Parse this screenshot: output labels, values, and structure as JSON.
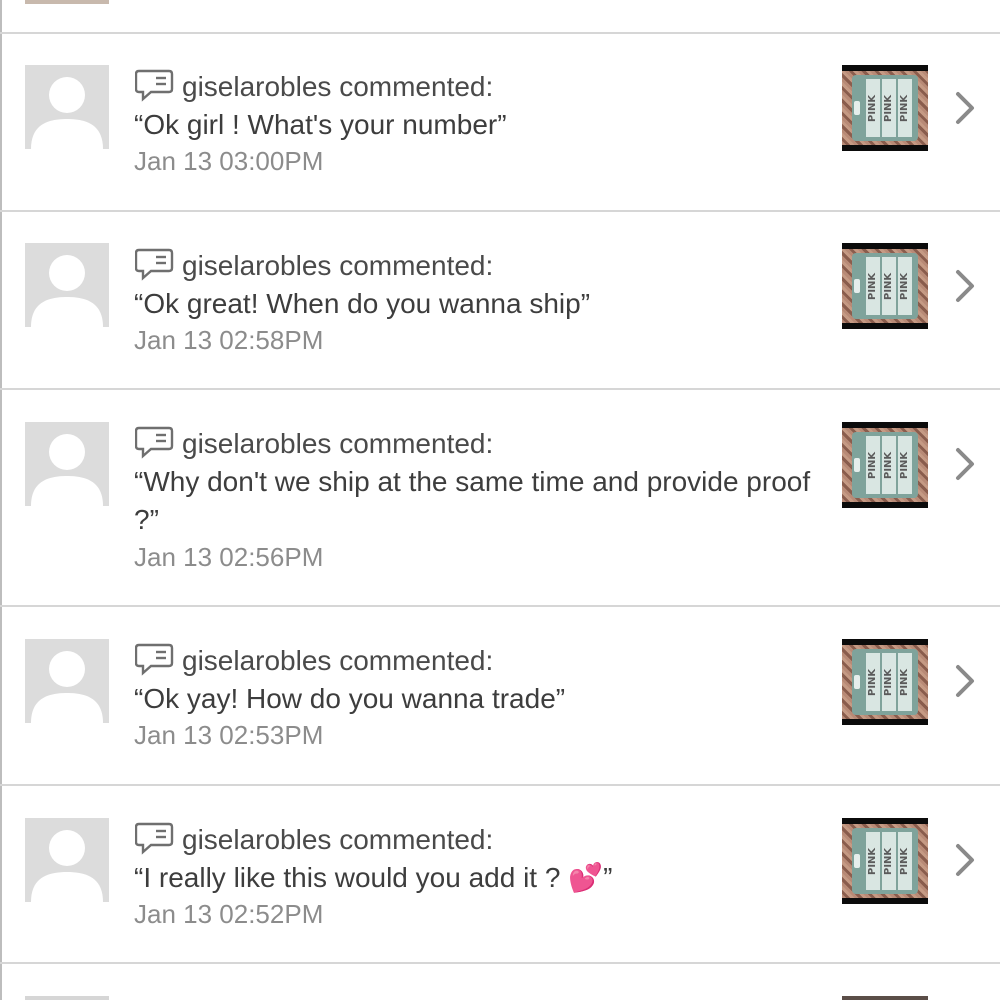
{
  "notifications": [
    {
      "user": "giselarobles commented:",
      "message": "“Ok girl ! What's your number”",
      "time": "Jan 13 03:00PM",
      "thumb_brand": "PINK"
    },
    {
      "user": "giselarobles commented:",
      "message": "“Ok great! When do you wanna ship”",
      "time": "Jan 13 02:58PM",
      "thumb_brand": "PINK"
    },
    {
      "user": "giselarobles commented:",
      "message": "“Why don't we ship at the same time and provide proof ?”",
      "time": "Jan 13 02:56PM",
      "thumb_brand": "PINK"
    },
    {
      "user": "giselarobles commented:",
      "message": "“Ok yay! How do you wanna trade”",
      "time": "Jan 13 02:53PM",
      "thumb_brand": "PINK"
    },
    {
      "user": "giselarobles commented:",
      "message": "“I really like this would you add it ? 💕”",
      "time": "Jan 13 02:52PM",
      "thumb_brand": "PINK"
    }
  ],
  "icons": {
    "comment": "speech-bubble-icon",
    "avatar": "default-avatar-icon",
    "chevron": "chevron-right-icon"
  },
  "colors": {
    "text": "#3d3d3d",
    "secondary_text": "#8c8c8c",
    "divider": "#d6d6d6",
    "avatar_bg": "#dcdcdc"
  }
}
